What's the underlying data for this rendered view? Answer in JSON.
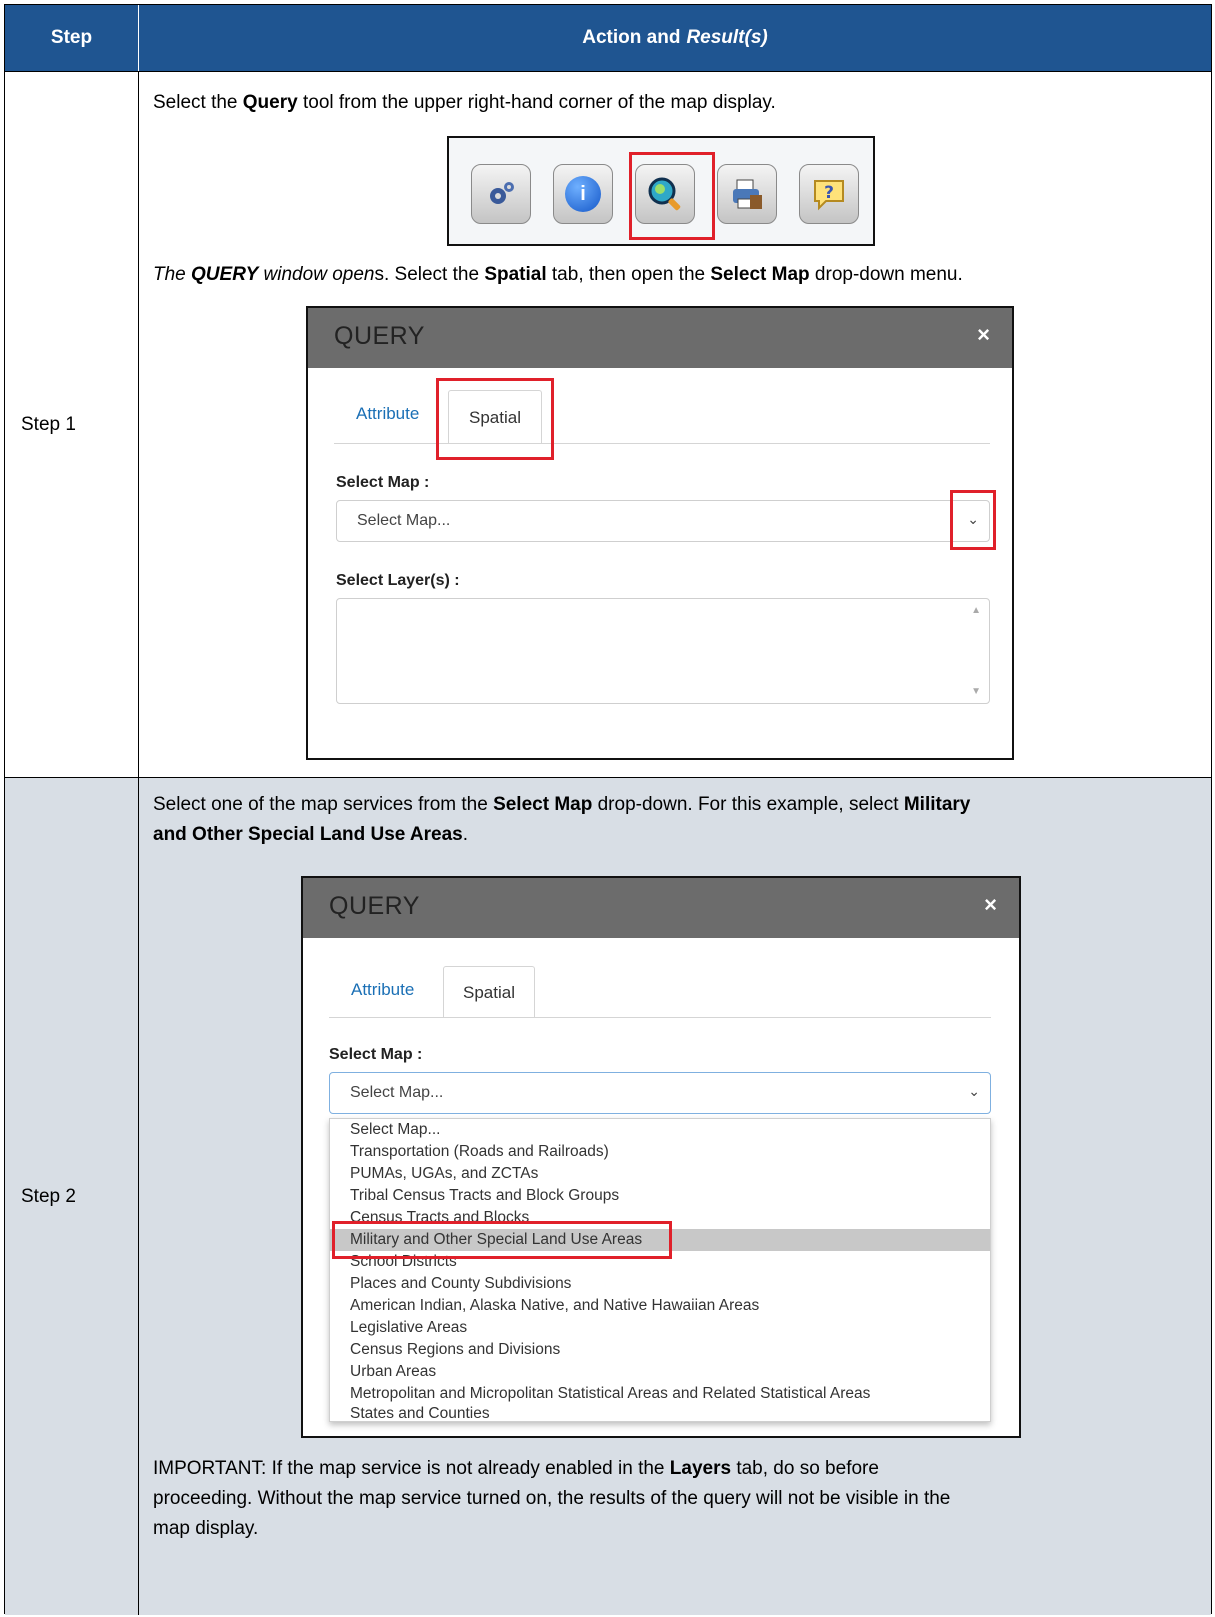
{
  "header": {
    "col_step": "Step",
    "col_action": "Action and",
    "col_action_italic": "Result(s)"
  },
  "step1": {
    "label": "Step 1",
    "instruction_pre": "Select the ",
    "instruction_bold": "Query",
    "instruction_post": " tool from the upper right-hand corner of the map display.",
    "toolbar_icons": [
      "settings-icon",
      "info-icon",
      "query-icon",
      "print-icon",
      "help-icon"
    ],
    "result_italic_pre": "The ",
    "result_bold_italic": "QUERY",
    "result_italic_mid": " window open",
    "result_post_s": "s. Select the ",
    "result_bold_spatial": "Spatial",
    "result_mid2": " tab, then open the ",
    "result_bold_selectmap": "Select Map",
    "result_end": " drop-down menu.",
    "dialog": {
      "title": "QUERY",
      "close": "×",
      "tab_attribute": "Attribute",
      "tab_spatial": "Spatial",
      "select_map_label": "Select Map :",
      "select_map_value": "Select Map...",
      "select_layers_label": "Select Layer(s) :"
    }
  },
  "step2": {
    "label": "Step 2",
    "instruction_pre": "Select one of the map services from the ",
    "instruction_bold1": "Select Map",
    "instruction_mid": " drop-down. For this example, select ",
    "instruction_bold2a": "Military",
    "instruction_bold2b": "and Other Special Land Use Areas",
    "instruction_end": ".",
    "dialog": {
      "title": "QUERY",
      "close": "×",
      "tab_attribute": "Attribute",
      "tab_spatial": "Spatial",
      "select_map_label": "Select Map :",
      "select_map_value": "Select Map...",
      "options": [
        "Select Map...",
        "Transportation (Roads and Railroads)",
        "PUMAs, UGAs, and ZCTAs",
        "Tribal Census Tracts and Block Groups",
        "Census Tracts and Blocks",
        "Military and Other Special Land Use Areas",
        "School Districts",
        "Places and County Subdivisions",
        "American Indian, Alaska Native, and Native Hawaiian Areas",
        "Legislative Areas",
        "Census Regions and Divisions",
        "Urban Areas",
        "Metropolitan and Micropolitan Statistical Areas and Related Statistical Areas",
        "States and Counties"
      ]
    },
    "important_pre": "IMPORTANT: If the map service is not already enabled in the ",
    "important_bold": "Layers",
    "important_l1_end": " tab, do so before",
    "important_l2": "proceeding. Without the map service turned on, the results of the query will not be visible in the",
    "important_l3": "map display."
  }
}
